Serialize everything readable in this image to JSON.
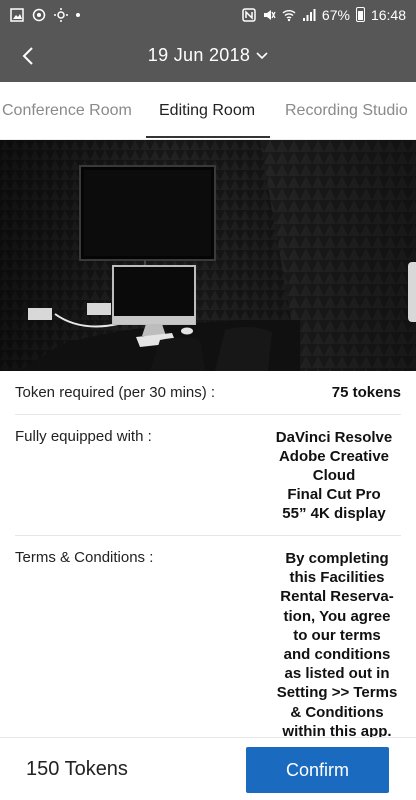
{
  "status_bar": {
    "time": "16:48",
    "battery": "67%",
    "icons": [
      "gallery-icon",
      "sync-icon",
      "settings-sun-icon",
      "dot-icon",
      "nfc-icon",
      "mute-icon",
      "wifi-icon",
      "signal-icon",
      "battery-icon"
    ]
  },
  "header": {
    "back_icon": "chevron-left-icon",
    "date": "19 Jun 2018",
    "date_icon": "chevron-down-icon"
  },
  "tabs": [
    {
      "label": "Conference Room",
      "active": false
    },
    {
      "label": "Editing Room",
      "active": true
    },
    {
      "label": "Recording Studio",
      "active": false
    }
  ],
  "details": {
    "token_label": "Token required (per 30 mins) :",
    "token_value": "75 tokens",
    "equip_label": "Fully equipped with :",
    "equip_items": [
      "DaVinci Resolve",
      "Adobe Creative",
      "Cloud",
      "Final Cut Pro",
      "55”  4K display"
    ],
    "terms_label": "Terms & Conditions :",
    "terms_lines": [
      "By completing",
      "this Facilities",
      "Rental Reserva-",
      "tion, You agree",
      "to our terms",
      "and conditions",
      "as listed out in",
      "Setting >> Terms",
      "& Conditions",
      "within this app."
    ]
  },
  "footer": {
    "token_total": "150 Tokens",
    "confirm_label": "Confirm"
  },
  "colors": {
    "header_bg": "#575757",
    "accent": "#1a6bbf"
  }
}
